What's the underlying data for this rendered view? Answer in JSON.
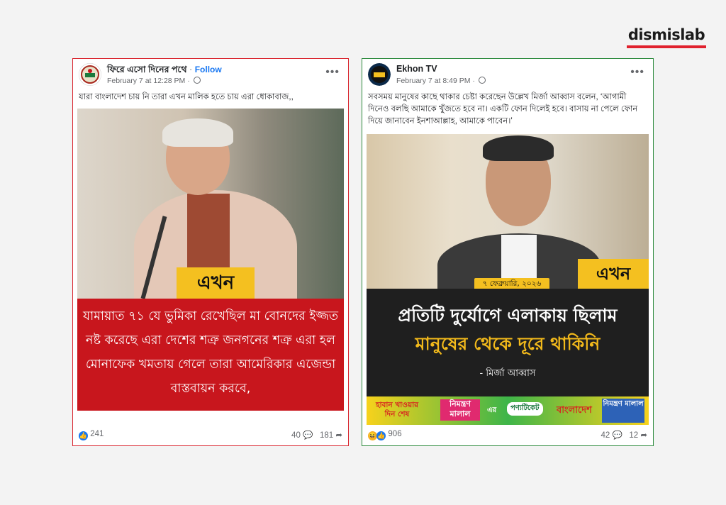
{
  "brand": {
    "name": "dismislab",
    "accent": "#e0212d"
  },
  "posts": [
    {
      "page_name": "ফিরে এসো দিনের পথে",
      "follow_label": "Follow",
      "timestamp": "February 7 at 12:28 PM",
      "audience_icon": "globe-icon",
      "caption": "যারা বাংলাদেশ চায় নি তারা এখন মালিক হতে চায় এরা ধোকাবাজ,,",
      "image": {
        "logo": "এখন",
        "banner_text": "যামায়াত ৭১ যে ভুমিকা রেখেছিল মা বোনদের ইজ্জত নষ্ট করেছে এরা দেশের শত্রু জনগনের শত্রু এরা হল মোনাফেক খমতায় গেলে তারা আমেরিকার এজেন্ডা বাস্তবায়ন করবে,"
      },
      "reactions": "241",
      "comments": "40",
      "shares": "181",
      "border_color": "#d9262f"
    },
    {
      "page_name": "Ekhon TV",
      "timestamp": "February 7 at 8:49 PM",
      "audience_icon": "globe-icon",
      "caption": "সবসময় মানুষের কাছে থাকার চেষ্টা করেছেন উল্লেখ মির্জা আব্বাস বলেন, ‘আগামী দিনেও বলছি আমাকে খুঁজতে হবে না। একটি ফোন দিলেই হবে। বাসায় না পেলে ফোন দিয়ে জানাবেন ইনশাআল্লাহ, আমাকে পাবেন।’",
      "image": {
        "date_badge": "৭ ফেব্রুয়ারি, ২০২৬",
        "logo": "এখন",
        "headline_1": "প্রতিটি দুর্যোগে এলাকায় ছিলাম",
        "headline_2": "মানুষের থেকে দূরে থাকিনি",
        "attribution": "- মির্জা আব্বাস",
        "ad": {
          "slogan": "হাবান খাওয়ার দিন শেষ",
          "brand_1": "নিমন্ত্রণ মালাল",
          "connector": "এর",
          "brand_2": "পণ্যটিকেট",
          "country": "বাংলাদেশ",
          "pack": "নিমন্ত্রণ মালাল"
        }
      },
      "reactions": "906",
      "comments": "42",
      "shares": "12",
      "border_color": "#2e8b3e"
    }
  ]
}
